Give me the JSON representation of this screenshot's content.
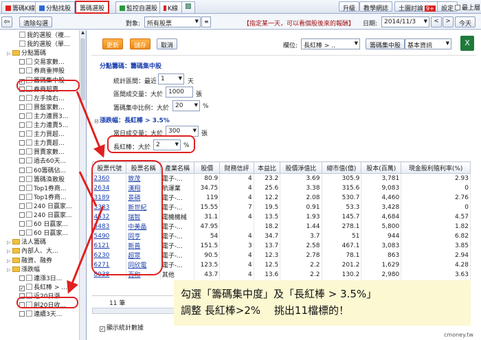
{
  "top_tabs": [
    {
      "label": "籌碼K線",
      "icon": "red"
    },
    {
      "label": "分點找股",
      "icon": "blue"
    },
    {
      "label": "籌碼選股",
      "icon": "none"
    },
    {
      "label": "監控自選股",
      "icon": "green"
    },
    {
      "label": "K線",
      "icon": "red"
    }
  ],
  "top_right": {
    "upgrade": "升級",
    "guide": "教學網誌",
    "forum": "土園討論",
    "forum_badge": "9+",
    "settings": "設定",
    "topmost": "最上層"
  },
  "toolbar": {
    "clear_checks": "清除勾選",
    "target_label": "對象:",
    "target_value": "所有股票",
    "hint": "【指定某一天，可以看個股後來的報酬】",
    "date_label": "日期:",
    "date_value": "2014/11/3",
    "today": "今天"
  },
  "actions": {
    "update": "更新",
    "save": "儲存",
    "cancel": "取消",
    "column_label": "欄位:",
    "column_value": "長紅棒 > ..",
    "concentration": "籌碼集中股",
    "info_value": "基本資訊"
  },
  "tree": [
    {
      "label": "我的選股（複...",
      "type": "doc",
      "indent": 1
    },
    {
      "label": "我的選股（單...",
      "type": "doc",
      "indent": 1
    },
    {
      "label": "分點籌碼",
      "type": "folder",
      "indent": 0
    },
    {
      "label": "交易家數...",
      "type": "cb",
      "indent": 1
    },
    {
      "label": "券商重押股",
      "type": "cb",
      "indent": 1
    },
    {
      "label": "籌碼集中股",
      "type": "cb",
      "indent": 1,
      "checked": true
    },
    {
      "label": "券商超賣...",
      "type": "cb",
      "indent": 1
    },
    {
      "label": "左手換右...",
      "type": "cb",
      "indent": 1
    },
    {
      "label": "買盤家數...",
      "type": "cb",
      "indent": 1
    },
    {
      "label": "主力連買3...",
      "type": "cb",
      "indent": 1
    },
    {
      "label": "主力連賣5...",
      "type": "cb",
      "indent": 1
    },
    {
      "label": "主力買超...",
      "type": "cb",
      "indent": 1
    },
    {
      "label": "主力賣超...",
      "type": "cb",
      "indent": 1
    },
    {
      "label": "買賣家數...",
      "type": "cb",
      "indent": 1
    },
    {
      "label": "過去60天...",
      "type": "cb",
      "indent": 1
    },
    {
      "label": "60籌碼佔...",
      "type": "cb",
      "indent": 1
    },
    {
      "label": "籌碼渙散股",
      "type": "cb",
      "indent": 1
    },
    {
      "label": "Top1券商...",
      "type": "cb",
      "indent": 1
    },
    {
      "label": "Top1券商...",
      "type": "cb",
      "indent": 1
    },
    {
      "label": "240 日赢家...",
      "type": "cb",
      "indent": 1
    },
    {
      "label": "240 日赢家...",
      "type": "cb",
      "indent": 1
    },
    {
      "label": "60 日赢家...",
      "type": "cb",
      "indent": 1
    },
    {
      "label": "60 日赢家...",
      "type": "cb",
      "indent": 1
    },
    {
      "label": "法人籌碼",
      "type": "folder",
      "indent": 0
    },
    {
      "label": "內部人、大...",
      "type": "folder",
      "indent": 0
    },
    {
      "label": "融資、融券",
      "type": "folder",
      "indent": 0
    },
    {
      "label": "漲跌幅",
      "type": "folder",
      "indent": 0
    },
    {
      "label": "連漲3日...",
      "type": "cb",
      "indent": 1
    },
    {
      "label": "長紅棒 > ...",
      "type": "cb",
      "indent": 1,
      "checked": true
    },
    {
      "label": "近20日漲...",
      "type": "cb",
      "indent": 1
    },
    {
      "label": "創20日收...",
      "type": "cb",
      "indent": 1
    },
    {
      "label": "連續3天...",
      "type": "cb",
      "indent": 1
    }
  ],
  "criteria": {
    "group1_title": "分點籌碼：籌碼集中股",
    "period_label": "統計區間：最近",
    "period_value": "1",
    "period_unit": "天",
    "volume_label": "區間成交量：大於",
    "volume_value": "1000",
    "volume_unit": "張",
    "conc_label": "籌碼集中比例：大於",
    "conc_value": "20",
    "conc_unit": "%",
    "group2_title": "漲跌幅：長紅棒 > 3.5%",
    "day_vol_label": "當日成交量：大於",
    "day_vol_value": "300",
    "day_vol_unit": "張",
    "redbar_label": "長紅棒：大於",
    "redbar_value": "2",
    "redbar_unit": "%"
  },
  "table": {
    "headers": [
      "股票代號",
      "股票名稱",
      "產業名稱",
      "股價",
      "財務信評",
      "本益比",
      "股價淨值比",
      "總市值(億)",
      "股本(百萬)",
      "現金股利殖利率(%)"
    ],
    "rows": [
      [
        "2360",
        "致茂",
        "電子-...",
        "80.9",
        "4",
        "23.2",
        "3.69",
        "305.9",
        "3,781",
        "2.93"
      ],
      [
        "2634",
        "漢翔",
        "航運業",
        "34.75",
        "4",
        "25.6",
        "3.38",
        "315.6",
        "9,083",
        "0"
      ],
      [
        "3189",
        "景碩",
        "電子-...",
        "119",
        "4",
        "12.2",
        "2.08",
        "530.7",
        "4,460",
        "2.76"
      ],
      [
        "3383",
        "新世紀",
        "電子-...",
        "15.55",
        "7",
        "19.5",
        "0.91",
        "53.3",
        "3,428",
        "0"
      ],
      [
        "4532",
        "瑞智",
        "電機機械",
        "31.1",
        "4",
        "13.5",
        "1.93",
        "145.7",
        "4,684",
        "4.57"
      ],
      [
        "5483",
        "中美晶",
        "電子-...",
        "47.95",
        "",
        "18.2",
        "1.44",
        "278.1",
        "5,800",
        "1.82"
      ],
      [
        "5490",
        "同亨",
        "電子-...",
        "54",
        "4",
        "34.7",
        "3.7",
        "51",
        "944",
        "6.82"
      ],
      [
        "6121",
        "新普",
        "電子-...",
        "151.5",
        "3",
        "13.7",
        "2.58",
        "467.1",
        "3,083",
        "3.85"
      ],
      [
        "6230",
        "超眾",
        "電子-...",
        "90.5",
        "4",
        "12.3",
        "2.78",
        "78.1",
        "863",
        "2.94"
      ],
      [
        "6271",
        "同欣電",
        "電子-...",
        "123.5",
        "4",
        "12.5",
        "2.2",
        "201.2",
        "1,629",
        "4.28"
      ],
      [
        "8938",
        "百和",
        "其他",
        "43.7",
        "4",
        "13.6",
        "2.2",
        "130.2",
        "2,980",
        "3.63"
      ]
    ]
  },
  "footer": {
    "count": "11 筆",
    "show_stats": "顯示統計數據"
  },
  "note": {
    "line1": "勾選「籌碼集中度」及「長紅棒 > 3.5%」",
    "line2": "調整 長紅棒>2%　 挑出11檔標的！"
  },
  "watermark": "cmoney.tw"
}
